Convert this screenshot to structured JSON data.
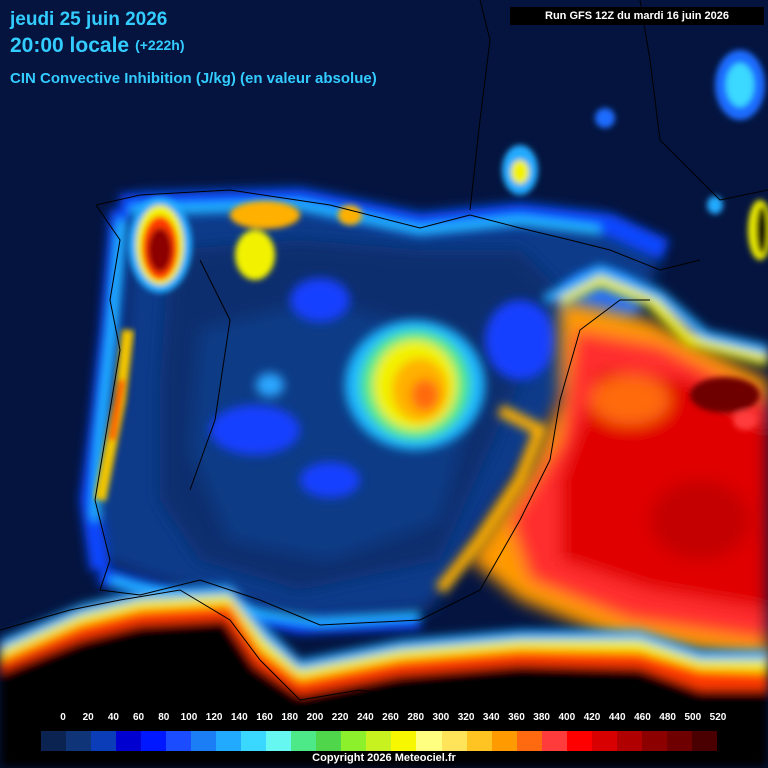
{
  "header": {
    "date": "jeudi 25 juin 2026",
    "time": "20:00 locale",
    "offset": "(+222h)",
    "field": "CIN Convective Inhibition (J/kg) (en valeur absolue)",
    "run": "Run GFS 12Z du mardi 16 juin 2026"
  },
  "legend": {
    "ticks": [
      "0",
      "20",
      "40",
      "60",
      "80",
      "100",
      "120",
      "140",
      "160",
      "180",
      "200",
      "220",
      "240",
      "260",
      "280",
      "300",
      "320",
      "340",
      "360",
      "380",
      "400",
      "420",
      "440",
      "460",
      "480",
      "500",
      "520"
    ],
    "colors": [
      "#0a2350",
      "#0f3478",
      "#0b3db8",
      "#0000d0",
      "#0018ff",
      "#1c4cff",
      "#1b7ef5",
      "#22aaff",
      "#3ad8ff",
      "#66f7f0",
      "#4de888",
      "#4fd64b",
      "#8cf02c",
      "#c8f21f",
      "#f6f700",
      "#ffff80",
      "#ffe45a",
      "#ffc421",
      "#ff9a00",
      "#ff6a10",
      "#ff3b3b",
      "#ff0000",
      "#d80000",
      "#b00000",
      "#8c0000",
      "#6e0000",
      "#4a0000"
    ]
  },
  "footer": {
    "copyright": "Copyright 2026 Meteociel.fr"
  }
}
